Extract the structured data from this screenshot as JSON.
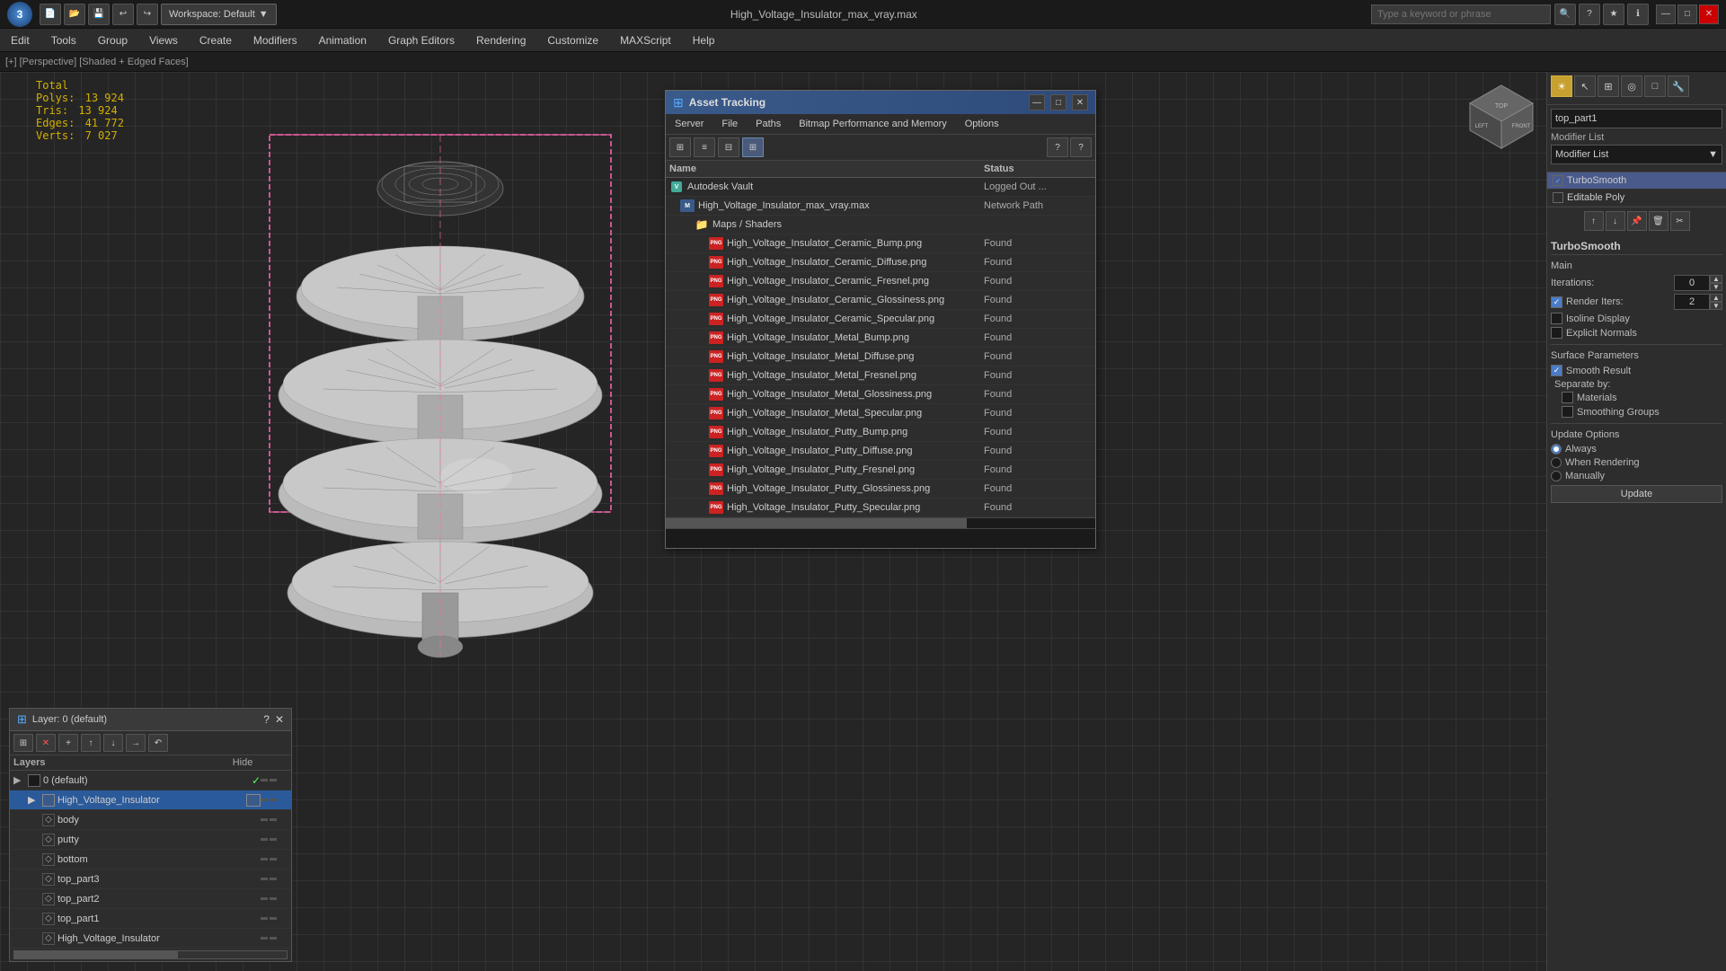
{
  "app": {
    "title": "High_Voltage_Insulator_max_vray.max",
    "workspace": "Workspace: Default",
    "icon_label": "3",
    "search_placeholder": "Type a keyword or phrase"
  },
  "titlebar": {
    "toolbar": [
      "📁",
      "📂",
      "💾",
      "↩",
      "↪",
      "🖥",
      "▼"
    ],
    "win_buttons": [
      "—",
      "□",
      "✕"
    ]
  },
  "menubar": {
    "items": [
      "Edit",
      "Tools",
      "Group",
      "Views",
      "Create",
      "Modifiers",
      "Animation",
      "Graph Editors",
      "Rendering",
      "Customize",
      "MAXScript",
      "Help"
    ]
  },
  "viewport": {
    "label": "[+] [Perspective] [Shaded + Edged Faces]",
    "stats": {
      "total_label": "Total",
      "polys_label": "Polys:",
      "polys_value": "13 924",
      "tris_label": "Tris:",
      "tris_value": "13 924",
      "edges_label": "Edges:",
      "edges_value": "41 772",
      "verts_label": "Verts:",
      "verts_value": "7 027"
    }
  },
  "layers_panel": {
    "title": "Layer: 0 (default)",
    "layers_label": "Layers",
    "hide_label": "Hide",
    "items": [
      {
        "name": "0 (default)",
        "level": 0,
        "checked": true
      },
      {
        "name": "High_Voltage_Insulator",
        "level": 1,
        "checked": false,
        "selected": true
      },
      {
        "name": "body",
        "level": 2
      },
      {
        "name": "putty",
        "level": 2
      },
      {
        "name": "bottom",
        "level": 2
      },
      {
        "name": "top_part3",
        "level": 2
      },
      {
        "name": "top_part2",
        "level": 2
      },
      {
        "name": "top_part1",
        "level": 2
      },
      {
        "name": "High_Voltage_Insulator",
        "level": 2
      }
    ]
  },
  "asset_panel": {
    "title": "Asset Tracking",
    "icon": "⊞",
    "menu_items": [
      "Server",
      "File",
      "Paths",
      "Bitmap Performance and Memory",
      "Options"
    ],
    "col_name": "Name",
    "col_status": "Status",
    "rows": [
      {
        "name": "Autodesk Vault",
        "status": "Logged Out ...",
        "level": 0,
        "icon": "vault"
      },
      {
        "name": "High_Voltage_Insulator_max_vray.max",
        "status": "Network Path",
        "level": 1,
        "icon": "max"
      },
      {
        "name": "Maps / Shaders",
        "status": "",
        "level": 2,
        "icon": "folder"
      },
      {
        "name": "High_Voltage_Insulator_Ceramic_Bump.png",
        "status": "Found",
        "level": 3,
        "icon": "png"
      },
      {
        "name": "High_Voltage_Insulator_Ceramic_Diffuse.png",
        "status": "Found",
        "level": 3,
        "icon": "png"
      },
      {
        "name": "High_Voltage_Insulator_Ceramic_Fresnel.png",
        "status": "Found",
        "level": 3,
        "icon": "png"
      },
      {
        "name": "High_Voltage_Insulator_Ceramic_Glossiness.png",
        "status": "Found",
        "level": 3,
        "icon": "png"
      },
      {
        "name": "High_Voltage_Insulator_Ceramic_Specular.png",
        "status": "Found",
        "level": 3,
        "icon": "png"
      },
      {
        "name": "High_Voltage_Insulator_Metal_Bump.png",
        "status": "Found",
        "level": 3,
        "icon": "png"
      },
      {
        "name": "High_Voltage_Insulator_Metal_Diffuse.png",
        "status": "Found",
        "level": 3,
        "icon": "png"
      },
      {
        "name": "High_Voltage_Insulator_Metal_Fresnel.png",
        "status": "Found",
        "level": 3,
        "icon": "png"
      },
      {
        "name": "High_Voltage_Insulator_Metal_Glossiness.png",
        "status": "Found",
        "level": 3,
        "icon": "png"
      },
      {
        "name": "High_Voltage_Insulator_Metal_Specular.png",
        "status": "Found",
        "level": 3,
        "icon": "png"
      },
      {
        "name": "High_Voltage_Insulator_Putty_Bump.png",
        "status": "Found",
        "level": 3,
        "icon": "png"
      },
      {
        "name": "High_Voltage_Insulator_Putty_Diffuse.png",
        "status": "Found",
        "level": 3,
        "icon": "png"
      },
      {
        "name": "High_Voltage_Insulator_Putty_Fresnel.png",
        "status": "Found",
        "level": 3,
        "icon": "png"
      },
      {
        "name": "High_Voltage_Insulator_Putty_Glossiness.png",
        "status": "Found",
        "level": 3,
        "icon": "png"
      },
      {
        "name": "High_Voltage_Insulator_Putty_Specular.png",
        "status": "Found",
        "level": 3,
        "icon": "png"
      }
    ]
  },
  "right_panel": {
    "modifier_name": "top_part1",
    "modifier_list_label": "Modifier List",
    "modifiers": [
      {
        "name": "TurboSmooth",
        "active": true,
        "checked": true
      },
      {
        "name": "Editable Poly",
        "active": false,
        "checked": false
      }
    ],
    "turbos_title": "TurboSmooth",
    "main_label": "Main",
    "iterations_label": "Iterations:",
    "iterations_value": "0",
    "render_iters_label": "Render Iters:",
    "render_iters_value": "2",
    "isoline_label": "Isoline Display",
    "explicit_normals_label": "Explicit Normals",
    "surface_params_label": "Surface Parameters",
    "smooth_result_label": "Smooth Result",
    "smooth_result_checked": true,
    "separate_by_label": "Separate by:",
    "materials_label": "Materials",
    "smoothing_groups_label": "Smoothing Groups",
    "update_options_label": "Update Options",
    "always_label": "Always",
    "when_rendering_label": "When Rendering",
    "manually_label": "Manually",
    "update_label": "Update"
  }
}
